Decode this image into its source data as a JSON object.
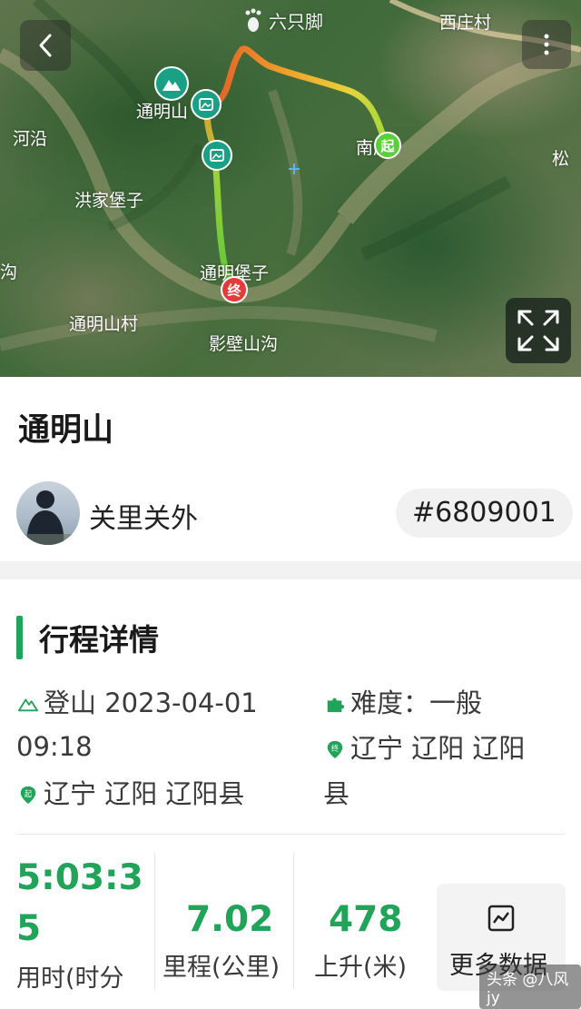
{
  "map": {
    "brand": "六只脚",
    "labels": {
      "xizhuang": "西庄村",
      "tongmingshan": "通明山",
      "hegou": "河沿",
      "nanzhuang": "南庄",
      "song": "松",
      "hongjiabaozi": "洪家堡子",
      "tongmingbaozi": "通明堡子",
      "tongmingshancun": "通明山村",
      "yingbishangou": "影壁山沟",
      "gou": "沟"
    },
    "icons": {
      "back": "chevron-left-icon",
      "more": "more-vertical-icon",
      "expand": "expand-icon",
      "start_pin": "起",
      "end_pin": "终"
    },
    "route_colors": [
      "#e15b27",
      "#f0a22b",
      "#e6d43a",
      "#a5d83b",
      "#4fc93a"
    ]
  },
  "trip": {
    "title": "通明山",
    "author": "关里关外",
    "id": "#6809001"
  },
  "details": {
    "section_title": "行程详情",
    "activity": "登山 2023-04-01 09:18",
    "activity_line1": "登山 2023-04-01",
    "activity_line2": "09:18",
    "difficulty": "难度：一般",
    "end_location_line1": "辽宁 辽阳 辽阳",
    "end_location_line2": "县",
    "start_location": "辽宁 辽阳 辽阳县"
  },
  "stats": {
    "duration_value_line1": "5:03:3",
    "duration_value_line2": "5",
    "duration_label": "用时(时分",
    "distance_value": "7.02",
    "distance_label": "里程(公里)",
    "ascent_value": "478",
    "ascent_label": "上升(米)",
    "more_label": "更多数据"
  },
  "watermark": "头条 @八风jy",
  "colors": {
    "accent_green": "#22a35a",
    "section_bar": "#21a45a",
    "pin_teal": "#1aa085"
  }
}
